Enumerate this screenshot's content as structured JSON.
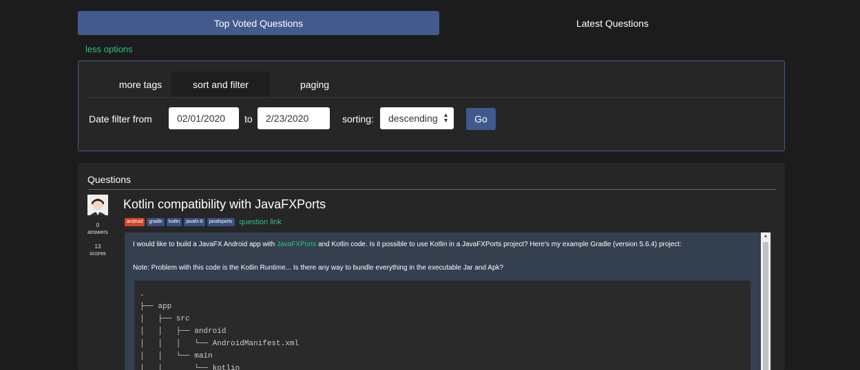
{
  "nav": {
    "tabs": [
      "Top Voted Questions",
      "Latest Questions"
    ]
  },
  "options": {
    "toggle_label": "less options",
    "tabs": [
      "more tags",
      "sort and filter",
      "paging"
    ],
    "date_label": "Date filter from",
    "from_value": "02/01/2020",
    "to_label": "to",
    "to_value": "2/23/2020",
    "sorting_label": "sorting:",
    "sorting_value": "descending",
    "go_label": "Go"
  },
  "questions": {
    "heading": "Questions",
    "item": {
      "title": "Kotlin compatibility with JavaFXPorts",
      "answers_count": "0",
      "answers_label": "answers",
      "scores_count": "13",
      "scores_label": "scores",
      "tags": [
        "android",
        "gradle",
        "kotlin",
        "javafx-8",
        "javafxports"
      ],
      "link_label": "question link",
      "body_line1_pre": "I would like to build a JavaFX Android app with ",
      "body_line1_link": "JavaFXPorts",
      "body_line1_post": " and Kotlin code. Is it possible to use Kotlin in a JavaFXPorts project? Here's my example Gradle (version 5.6.4) project:",
      "body_line2": "Note: Problem with this code is the Kotlin Runtime... Is there any way to bundle everything in the executable Jar and Apk?",
      "code_lines": [
        ".",
        "├── app",
        "│   ├── src",
        "│   │   ├── android",
        "│   │   │   └── AndroidManifest.xml",
        "│   │   └── main",
        "│   │       └── kotlin"
      ]
    }
  }
}
